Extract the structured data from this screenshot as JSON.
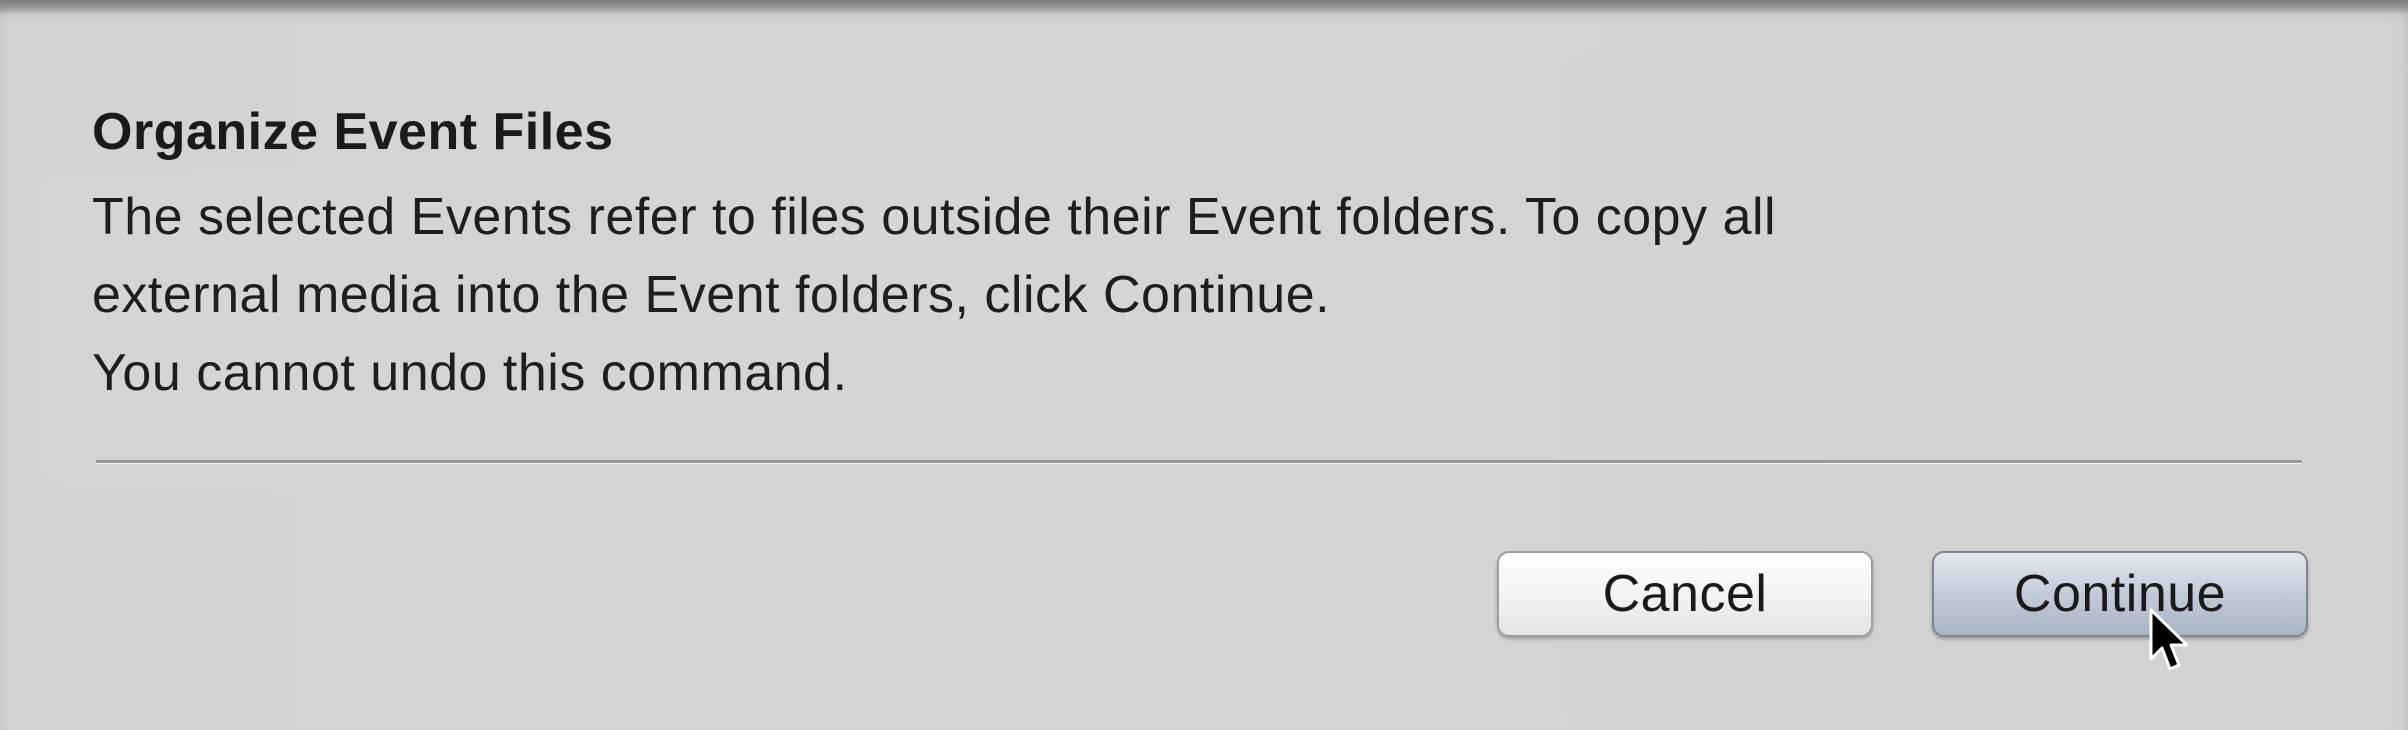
{
  "dialog": {
    "title": "Organize Event Files",
    "message_lines": [
      "The selected Events refer to files outside their Event folders. To copy all",
      "external media into the Event folders, click Continue.",
      "You cannot undo this command."
    ],
    "buttons": {
      "cancel_label": "Cancel",
      "continue_label": "Continue"
    }
  },
  "cursor": {
    "icon": "arrow-pointer-icon"
  },
  "colors": {
    "sheet_background": "#dedede",
    "default_button": "#c3cbd8",
    "text": "#1a1a1a"
  }
}
